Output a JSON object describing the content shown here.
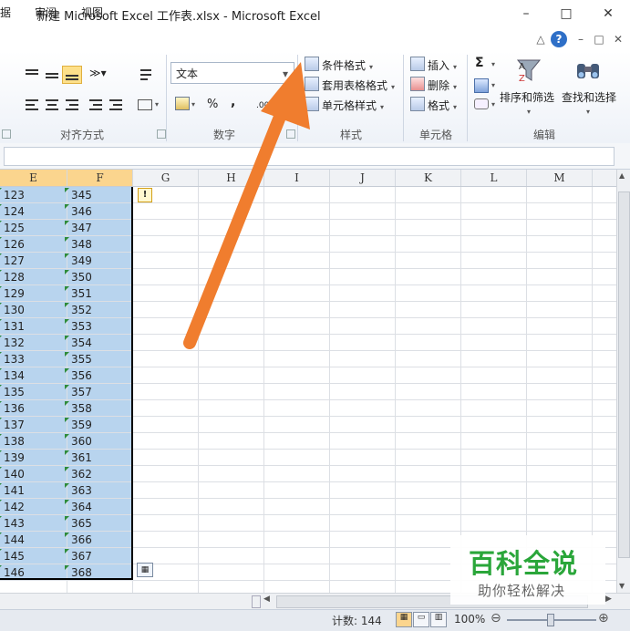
{
  "window": {
    "title": "新建 Microsoft Excel 工作表.xlsx - Microsoft Excel",
    "minimize": "–",
    "maximize": "□",
    "close": "✕"
  },
  "menu": {
    "items": [
      "据",
      "审阅",
      "视图"
    ]
  },
  "ribbon_top_icons": [
    "△",
    "?",
    "–",
    "□",
    "✕"
  ],
  "ribbon": {
    "alignment_label": "对齐方式",
    "number": {
      "format": "文本",
      "percent": "%",
      "comma": ",",
      "decimal": ".00",
      "label": "数字"
    },
    "styles": {
      "conditional_format": "条件格式",
      "table_format": "套用表格格式",
      "cell_style": "单元格样式",
      "label": "样式"
    },
    "cells": {
      "insert": "插入",
      "delete": "删除",
      "format": "格式",
      "label": "单元格"
    },
    "editing": {
      "sum": "Σ",
      "sort_filter": "排序和筛选",
      "find_select": "查找和选择",
      "label": "编辑"
    }
  },
  "columns": [
    "E",
    "F",
    "G",
    "H",
    "I",
    "J",
    "K",
    "L",
    "M"
  ],
  "data_rows": [
    [
      "123",
      "345"
    ],
    [
      "124",
      "346"
    ],
    [
      "125",
      "347"
    ],
    [
      "126",
      "348"
    ],
    [
      "127",
      "349"
    ],
    [
      "128",
      "350"
    ],
    [
      "129",
      "351"
    ],
    [
      "130",
      "352"
    ],
    [
      "131",
      "353"
    ],
    [
      "132",
      "354"
    ],
    [
      "133",
      "355"
    ],
    [
      "134",
      "356"
    ],
    [
      "135",
      "357"
    ],
    [
      "136",
      "358"
    ],
    [
      "137",
      "359"
    ],
    [
      "138",
      "360"
    ],
    [
      "139",
      "361"
    ],
    [
      "140",
      "362"
    ],
    [
      "141",
      "363"
    ],
    [
      "142",
      "364"
    ],
    [
      "143",
      "365"
    ],
    [
      "144",
      "366"
    ],
    [
      "145",
      "367"
    ],
    [
      "146",
      "368"
    ]
  ],
  "status": {
    "count": "计数: 144",
    "zoom": "100%",
    "zoom_minus": "⊖",
    "zoom_plus": "⊕"
  },
  "watermark": {
    "line1": "百科全说",
    "line2": "助你轻松解决"
  },
  "colors": {
    "selection": "#b8d4ee",
    "arrow": "#f07d2e",
    "watermark_green": "#2aa63a",
    "header_selected": "#fbd58e"
  }
}
